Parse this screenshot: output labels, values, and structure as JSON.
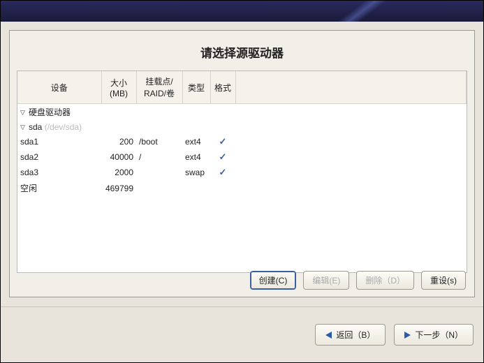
{
  "title": "请选择源驱动器",
  "columns": {
    "device": "设备",
    "size": "大小 (MB)",
    "mount": "挂载点/ RAID/卷",
    "type": "类型",
    "format": "格式"
  },
  "tree": {
    "root_label": "硬盘驱动器",
    "disk": {
      "name": "sda",
      "path": "(/dev/sda)"
    },
    "partitions": [
      {
        "name": "sda1",
        "size": "200",
        "mount": "/boot",
        "type": "ext4",
        "format_mark": "✓"
      },
      {
        "name": "sda2",
        "size": "40000",
        "mount": "/",
        "type": "ext4",
        "format_mark": "✓"
      },
      {
        "name": "sda3",
        "size": "2000",
        "mount": "",
        "type": "swap",
        "format_mark": "✓"
      },
      {
        "name": "空闲",
        "size": "469799",
        "mount": "",
        "type": "",
        "format_mark": ""
      }
    ]
  },
  "buttons": {
    "create": "创建(C)",
    "edit": "编辑(E)",
    "delete": "删除（D）",
    "reset": "重设(s)"
  },
  "nav": {
    "back": "返回（B）",
    "next": "下一步（N）"
  }
}
